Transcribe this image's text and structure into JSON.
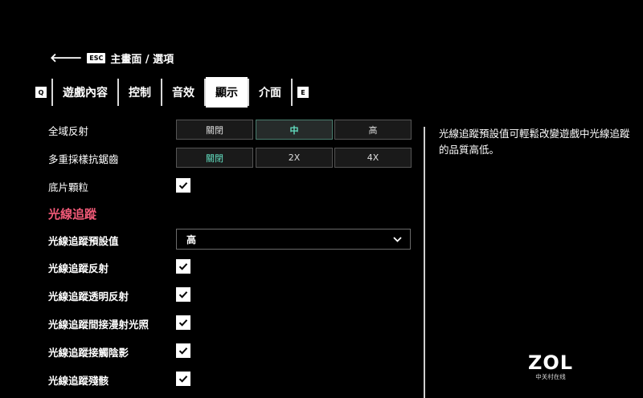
{
  "breadcrumb": {
    "back_icon": "arrow-left-icon",
    "key": "ESC",
    "text": "主畫面 / 選項"
  },
  "tabs": {
    "prev_key": "Q",
    "next_key": "E",
    "items": [
      {
        "label": "遊戲內容",
        "active": false
      },
      {
        "label": "控制",
        "active": false
      },
      {
        "label": "音效",
        "active": false
      },
      {
        "label": "顯示",
        "active": true
      },
      {
        "label": "介面",
        "active": false
      }
    ]
  },
  "settings": {
    "global_reflection": {
      "label": "全域反射",
      "options": [
        "關閉",
        "中",
        "高"
      ],
      "selected": "中"
    },
    "msaa": {
      "label": "多重採樣抗鋸齒",
      "options": [
        "關閉",
        "2X",
        "4X"
      ],
      "selected": "關閉"
    },
    "film_grain": {
      "label": "底片顆粒",
      "checked": true
    },
    "ray_tracing_section": "光線追蹤",
    "rt_preset": {
      "label": "光線追蹤預設值",
      "value": "高"
    },
    "rt_reflection": {
      "label": "光線追蹤反射",
      "checked": true
    },
    "rt_transparent": {
      "label": "光線追蹤透明反射",
      "checked": true
    },
    "rt_indirect": {
      "label": "光線追蹤間接漫射光照",
      "checked": true
    },
    "rt_contact_shadow": {
      "label": "光線追蹤接觸陰影",
      "checked": true
    },
    "rt_residual": {
      "label": "光線追蹤殘骸",
      "checked": true
    }
  },
  "description": "光線追蹤預設值可輕鬆改變遊戲中光線追蹤的品質高低。",
  "watermark": {
    "brand": "ZOL",
    "subtitle": "中关村在线"
  },
  "colors": {
    "accent_teal": "#63e0c2",
    "section_pink": "#f25a78",
    "background": "#000000"
  }
}
